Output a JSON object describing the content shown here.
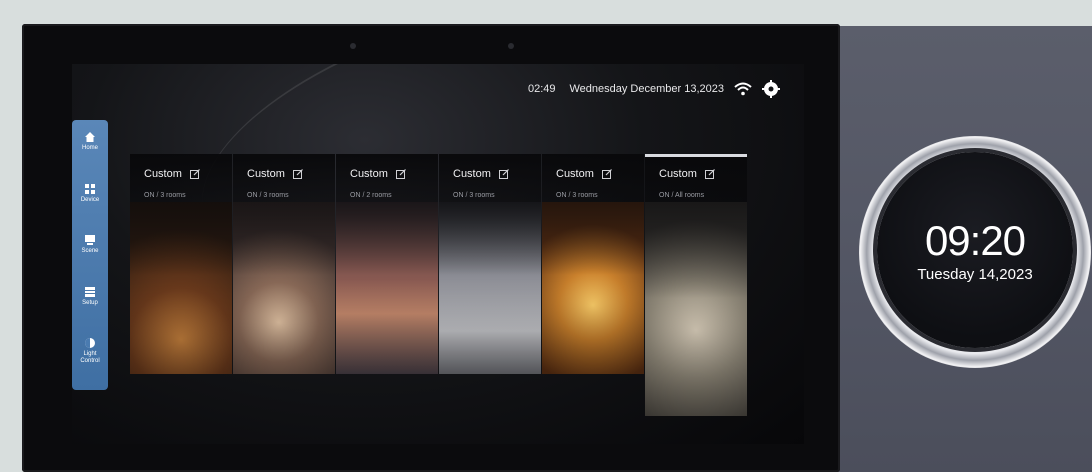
{
  "status_bar": {
    "time": "02:49",
    "date": "Wednesday December 13,2023",
    "icons": [
      "wifi-icon",
      "settings-icon"
    ]
  },
  "sidebar": {
    "items": [
      {
        "label": "Home",
        "icon": "home-icon"
      },
      {
        "label": "Device",
        "icon": "device-icon"
      },
      {
        "label": "Scene",
        "icon": "scene-icon"
      },
      {
        "label": "Setup",
        "icon": "setup-icon"
      },
      {
        "label": "Light Control",
        "icon": "light-control-icon"
      }
    ]
  },
  "scenes": [
    {
      "title": "Custom",
      "subtitle": "ON / 3 rooms",
      "icon": "edit-icon"
    },
    {
      "title": "Custom",
      "subtitle": "ON / 3 rooms",
      "icon": "edit-icon"
    },
    {
      "title": "Custom",
      "subtitle": "ON / 2 rooms",
      "icon": "edit-icon"
    },
    {
      "title": "Custom",
      "subtitle": "ON / 3 rooms",
      "icon": "edit-icon"
    },
    {
      "title": "Custom",
      "subtitle": "ON / 3 rooms",
      "icon": "edit-icon"
    },
    {
      "title": "Custom",
      "subtitle": "ON / All rooms",
      "icon": "edit-icon",
      "active": true
    }
  ],
  "wall_clock": {
    "time": "09:20",
    "date": "Tuesday 14,2023"
  },
  "colors": {
    "sidebar_accent": "#4a7bb0",
    "wall_panel": "#565966"
  }
}
